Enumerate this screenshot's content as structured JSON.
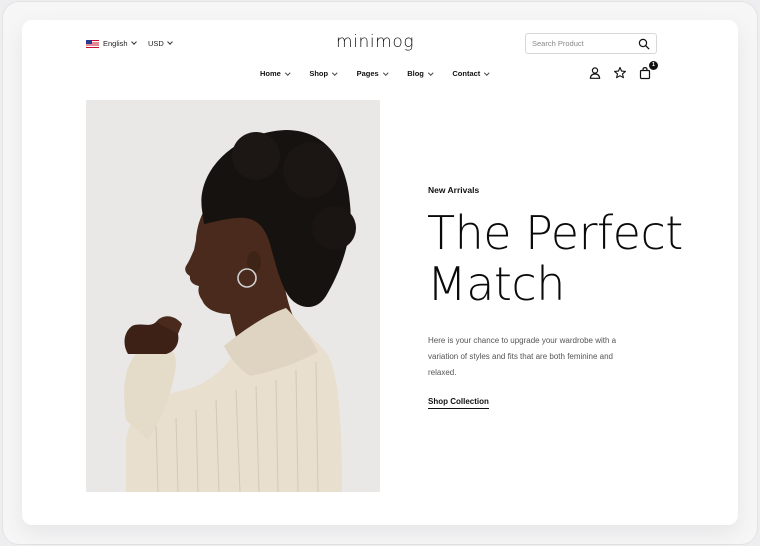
{
  "header": {
    "language": "English",
    "currency": "USD",
    "logo": "minimog",
    "search_placeholder": "Search Product",
    "cart_count": "1"
  },
  "nav": {
    "items": [
      {
        "label": "Home",
        "icon": "chevron-down-icon"
      },
      {
        "label": "Shop",
        "icon": "chevron-down-icon"
      },
      {
        "label": "Pages",
        "icon": "chevron-down-icon"
      },
      {
        "label": "Blog",
        "icon": "chevron-down-icon"
      },
      {
        "label": "Contact",
        "icon": "chevron-down-icon"
      }
    ],
    "icons": [
      "user-icon",
      "star-icon",
      "bag-icon"
    ]
  },
  "hero": {
    "eyebrow": "New Arrivals",
    "title_line1": "The Perfect",
    "title_line2": "Match",
    "description": "Here is your chance to upgrade your wardrobe with a variation of styles and fits that are both feminine and relaxed.",
    "cta_label": "Shop Collection",
    "image": "model-profile-photo"
  },
  "colors": {
    "text": "#111111",
    "muted": "#555555",
    "image_bg": "#e9e8e6",
    "sweater": "#e8dfcf"
  }
}
